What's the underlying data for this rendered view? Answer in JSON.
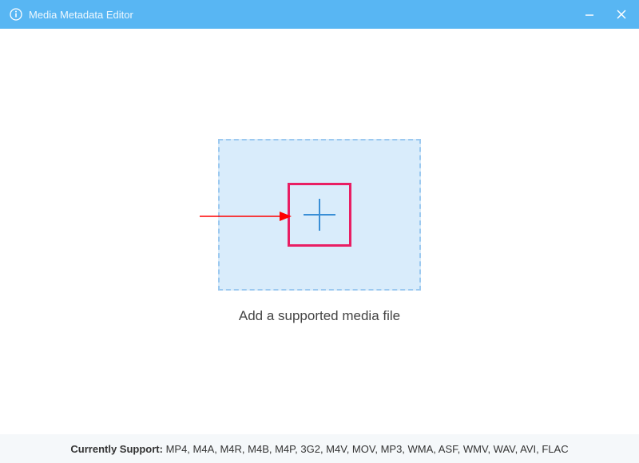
{
  "title_bar": {
    "title": "Media Metadata Editor"
  },
  "main": {
    "instruction": "Add a supported media file"
  },
  "status": {
    "label": "Currently Support: ",
    "formats": "MP4, M4A, M4R, M4B, M4P, 3G2, M4V, MOV, MP3, WMA, ASF, WMV, WAV, AVI, FLAC"
  }
}
